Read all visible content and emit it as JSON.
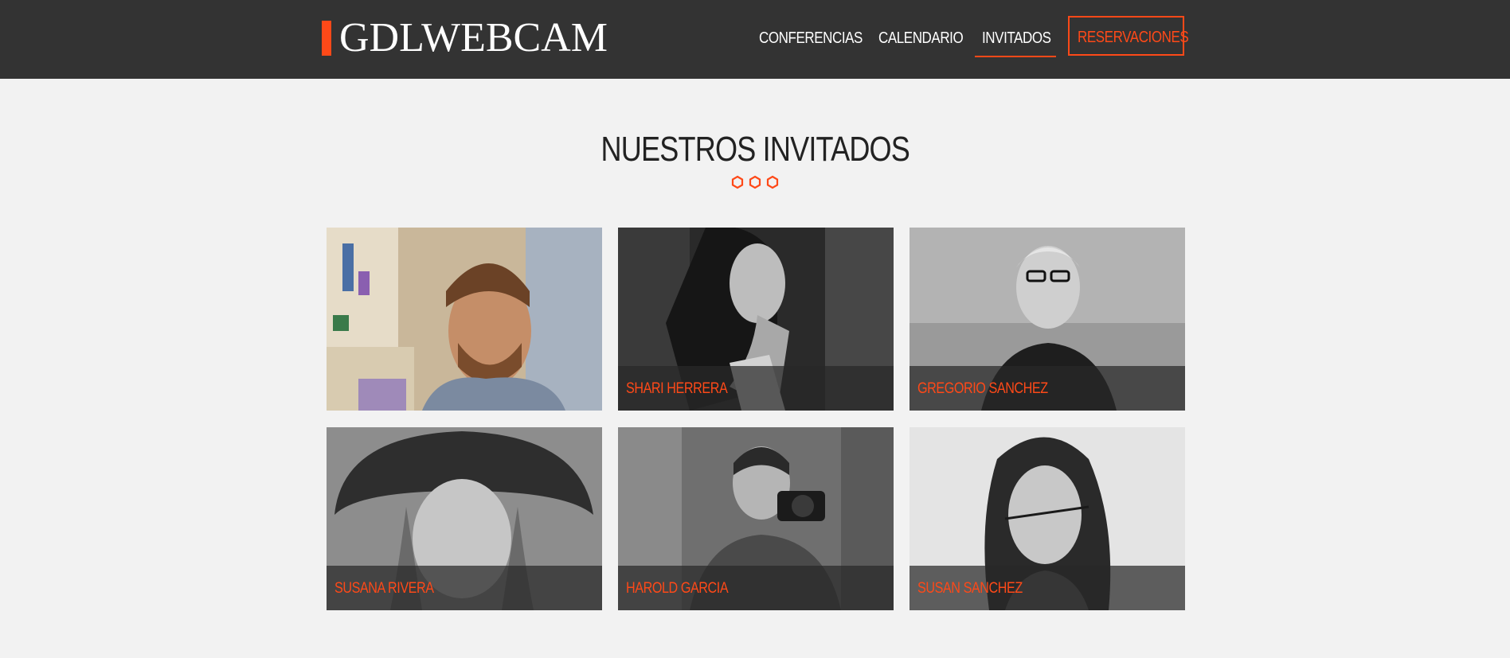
{
  "header": {
    "logo_text": "GDLWEBCAM",
    "nav": [
      {
        "label": "CONFERENCIAS"
      },
      {
        "label": "CALENDARIO"
      },
      {
        "label": "INVITADOS"
      }
    ],
    "cta_label": "RESERVACIONES"
  },
  "main": {
    "title": "NUESTROS INVITADOS",
    "guests": [
      {
        "name": ""
      },
      {
        "name": "SHARI HERRERA"
      },
      {
        "name": "GREGORIO SANCHEZ"
      },
      {
        "name": "SUSANA RIVERA"
      },
      {
        "name": "HAROLD GARCIA"
      },
      {
        "name": "SUSAN SANCHEZ"
      }
    ]
  },
  "colors": {
    "accent": "#fe4918",
    "header_bg": "#333333",
    "page_bg": "#f2f2f2"
  }
}
